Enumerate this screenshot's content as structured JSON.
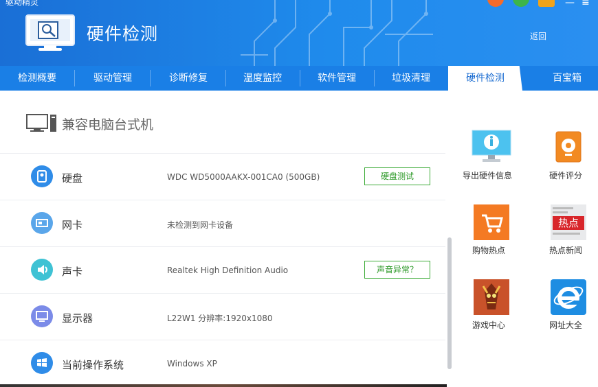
{
  "window": {
    "title_partial": "驱动精灵",
    "header_title": "硬件检测",
    "back_label": "返回"
  },
  "colors": {
    "header_blue": "#1f8bec",
    "tab_blue": "#1a7fe6",
    "active_tab_text": "#1f6fd2",
    "button_green": "#3aaa35"
  },
  "tabs": [
    {
      "label": "检测概要"
    },
    {
      "label": "驱动管理"
    },
    {
      "label": "诊断修复"
    },
    {
      "label": "温度监控"
    },
    {
      "label": "软件管理"
    },
    {
      "label": "垃圾清理"
    },
    {
      "label": "硬件检测",
      "active": true
    },
    {
      "label": "百宝箱"
    }
  ],
  "computer": {
    "icon": "desktop-computer-icon",
    "title": "兼容电脑台式机"
  },
  "devices": [
    {
      "icon": "hard-disk-icon",
      "label": "硬盘",
      "value": "WDC WD5000AAKX-001CA0 (500GB)",
      "button": "硬盘测试"
    },
    {
      "icon": "network-card-icon",
      "label": "网卡",
      "value": "未检测到网卡设备"
    },
    {
      "icon": "speaker-icon",
      "label": "声卡",
      "value": "Realtek High Definition Audio",
      "button": "声音异常？"
    },
    {
      "icon": "monitor-icon",
      "label": "显示器",
      "value": "L22W1  分辨率:1920x1080"
    },
    {
      "icon": "windows-icon",
      "label": "当前操作系统",
      "value": "Windows XP"
    }
  ],
  "tools": [
    {
      "icon": "info-monitor-icon",
      "label": "导出硬件信息"
    },
    {
      "icon": "hardware-score-icon",
      "label": "硬件评分"
    },
    {
      "icon": "shopping-cart-icon",
      "label": "购物热点"
    },
    {
      "icon": "hot-news-icon",
      "label": "热点新闻",
      "badge": "热点"
    },
    {
      "icon": "game-center-icon",
      "label": "游戏中心"
    },
    {
      "icon": "ie-browser-icon",
      "label": "网址大全"
    }
  ]
}
